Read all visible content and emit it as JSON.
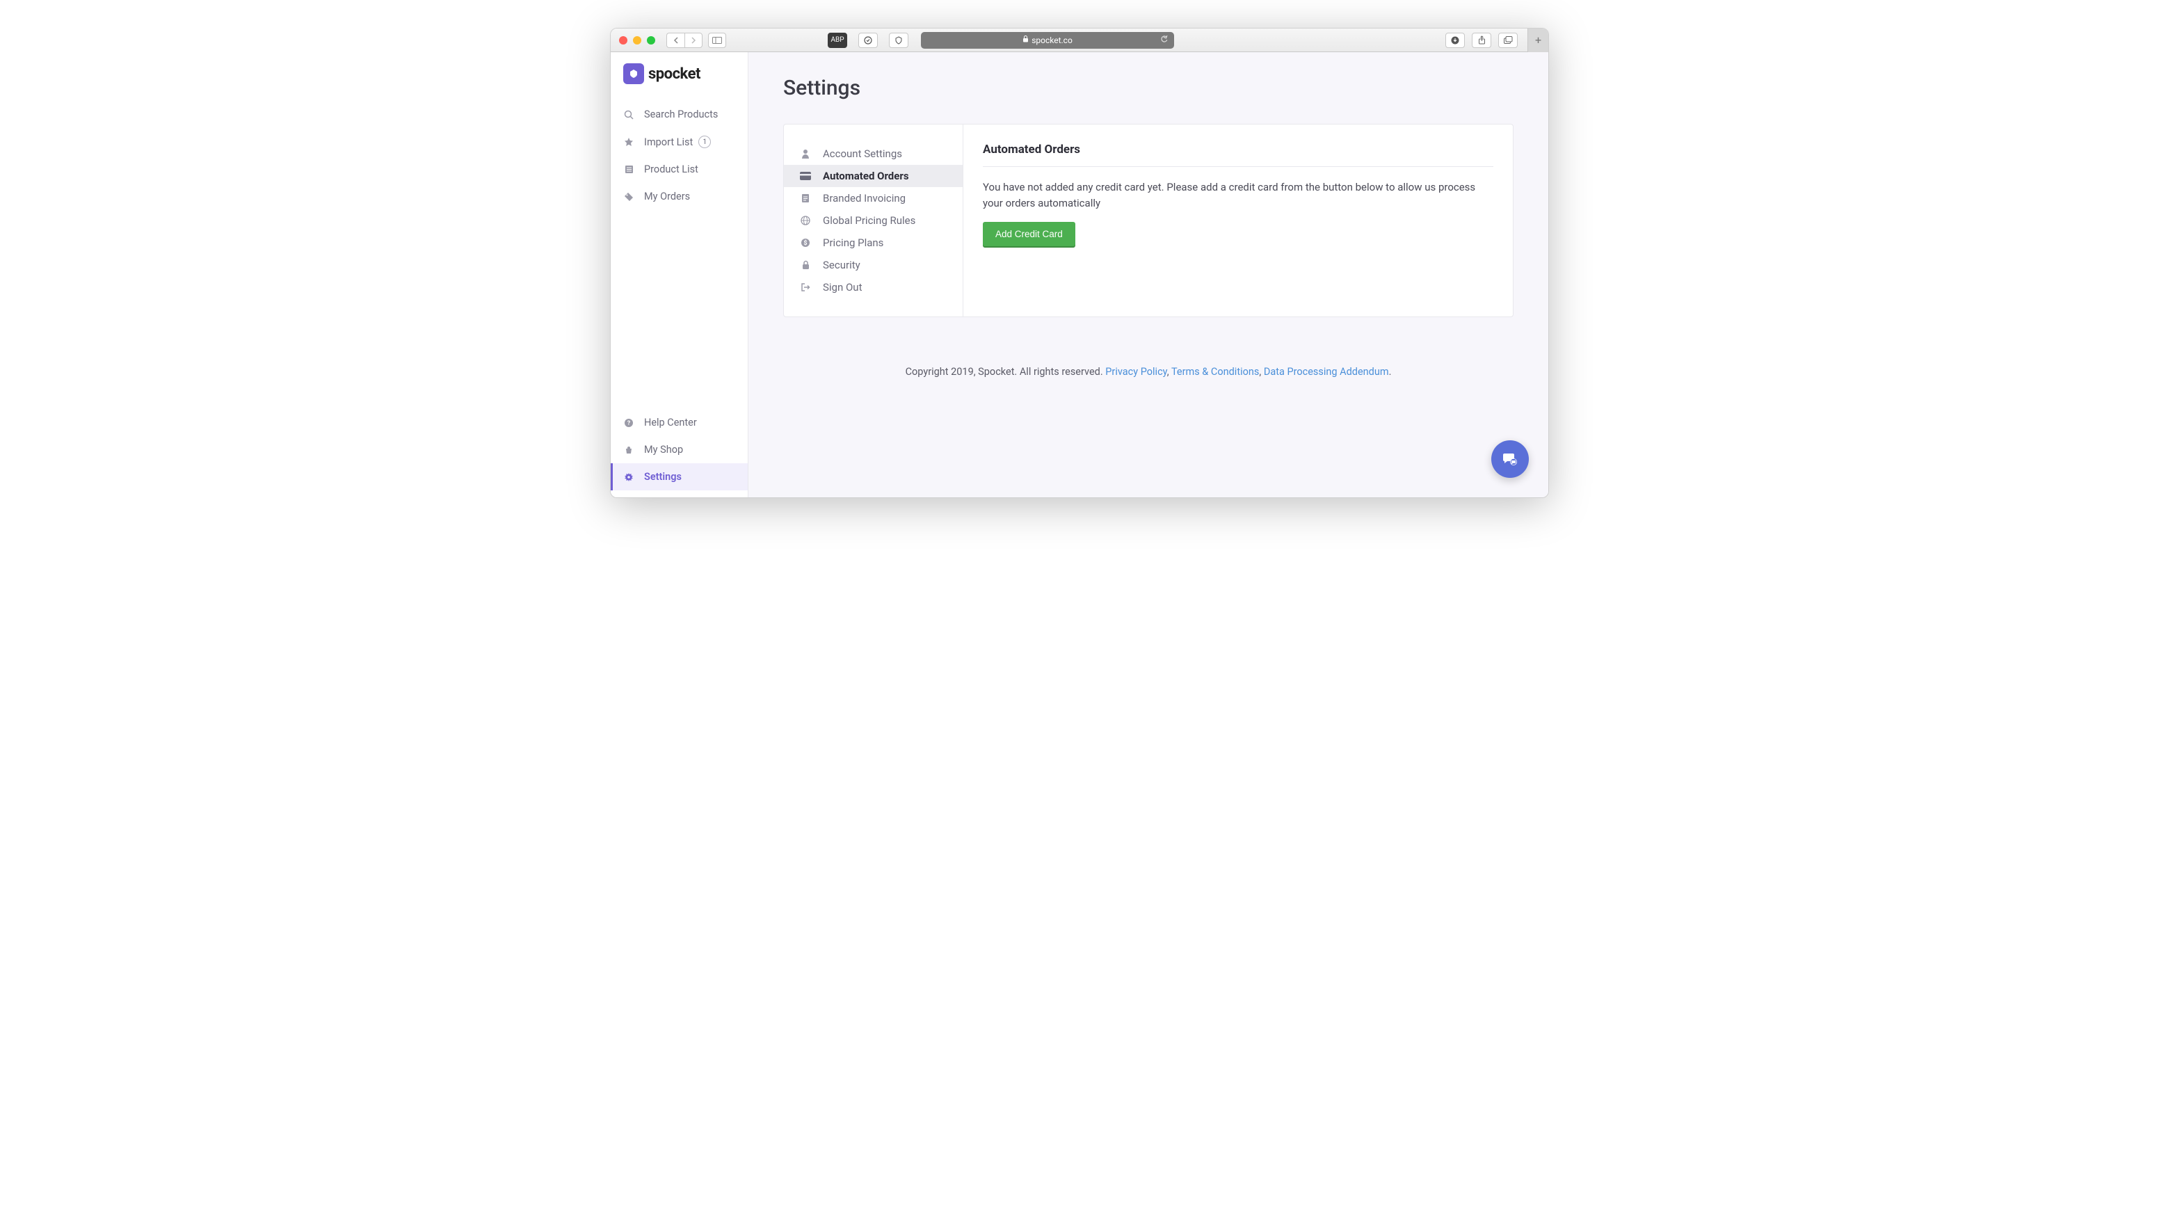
{
  "browser": {
    "url": "spocket.co"
  },
  "logo": {
    "text": "spocket"
  },
  "sidebar": {
    "items": [
      {
        "label": "Search Products",
        "icon": "search"
      },
      {
        "label": "Import List",
        "icon": "star",
        "badge": "1"
      },
      {
        "label": "Product List",
        "icon": "list"
      },
      {
        "label": "My Orders",
        "icon": "tag"
      }
    ],
    "bottomItems": [
      {
        "label": "Help Center",
        "icon": "help"
      },
      {
        "label": "My Shop",
        "icon": "shop"
      },
      {
        "label": "Settings",
        "icon": "gear",
        "active": true
      }
    ]
  },
  "page": {
    "title": "Settings"
  },
  "settingsNav": {
    "items": [
      {
        "label": "Account Settings",
        "icon": "person"
      },
      {
        "label": "Automated Orders",
        "icon": "card",
        "active": true
      },
      {
        "label": "Branded Invoicing",
        "icon": "clipboard"
      },
      {
        "label": "Global Pricing Rules",
        "icon": "globe"
      },
      {
        "label": "Pricing Plans",
        "icon": "dollar"
      },
      {
        "label": "Security",
        "icon": "lock"
      },
      {
        "label": "Sign Out",
        "icon": "signout"
      }
    ]
  },
  "content": {
    "heading": "Automated Orders",
    "body": "You have not added any credit card yet. Please add a credit card from the button below to allow us process your orders automatically",
    "button": "Add Credit Card"
  },
  "footer": {
    "copyright": "Copyright 2019, Spocket. All rights reserved. ",
    "links": {
      "privacy": "Privacy Policy",
      "terms": "Terms & Conditions",
      "dpa": "Data Processing Addendum"
    },
    "sep1": ", ",
    "sep2": ", ",
    "end": "."
  }
}
